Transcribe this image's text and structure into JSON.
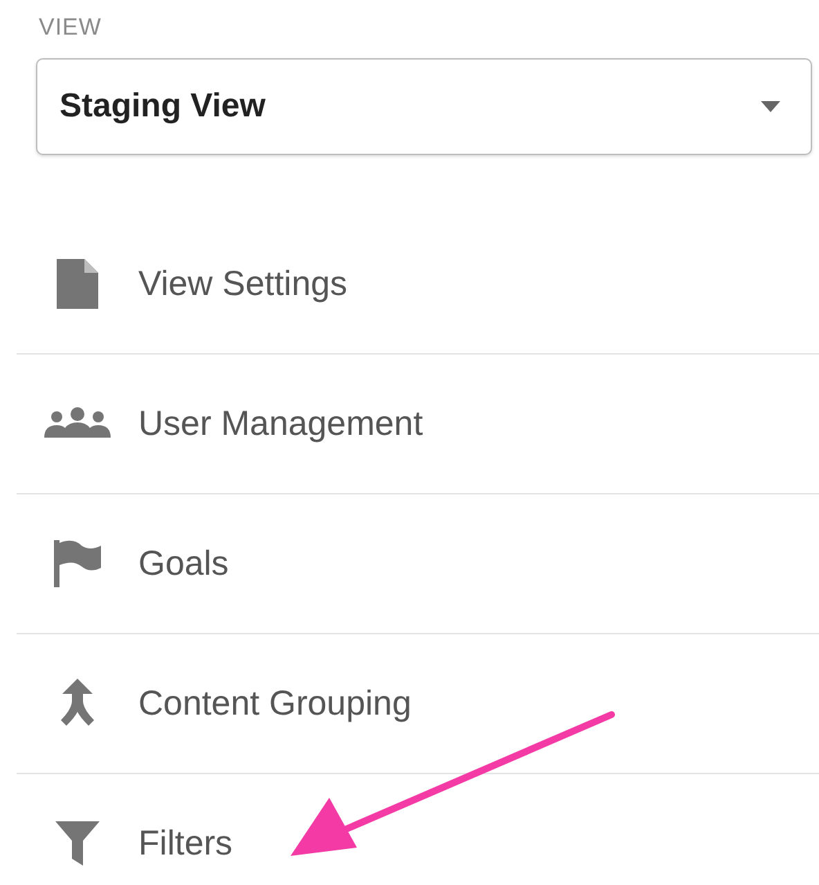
{
  "section_label": "VIEW",
  "view_select": {
    "value": "Staging View"
  },
  "menu_items": [
    {
      "label": "View Settings"
    },
    {
      "label": "User Management"
    },
    {
      "label": "Goals"
    },
    {
      "label": "Content Grouping"
    },
    {
      "label": "Filters"
    }
  ]
}
